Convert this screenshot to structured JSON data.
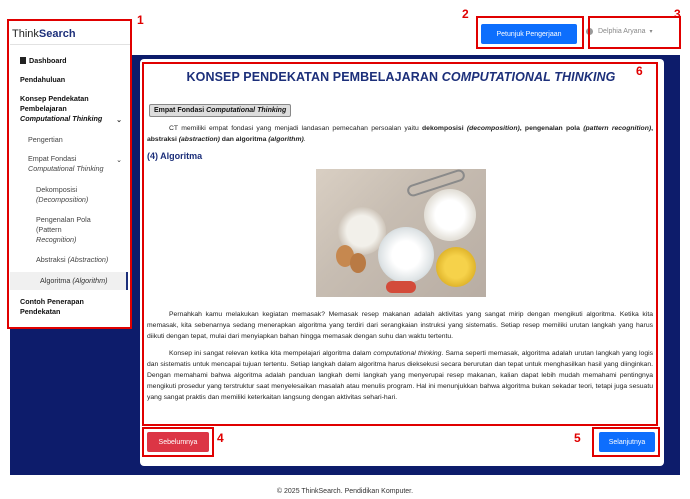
{
  "brand": {
    "prefix": "Think",
    "strong": "Search"
  },
  "topbar": {
    "guide_button": "Petunjuk Pengerjaan",
    "user_name": "Delphia Aryana"
  },
  "sidebar": {
    "items": [
      {
        "label": "Dashboard"
      },
      {
        "label": "Pendahuluan"
      },
      {
        "label_line1": "Konsep Pendekatan",
        "label_line2": "Pembelajaran",
        "label_line3": "Computational Thinking"
      },
      {
        "label": "Pengertian"
      },
      {
        "label_line1": "Empat Fondasi",
        "label_line2": "Computational Thinking"
      },
      {
        "label_line1": "Dekomposisi",
        "label_line2": "(Decomposition)"
      },
      {
        "label_line1": "Pengenalan Pola (Pattern",
        "label_line2": "Recognition)"
      },
      {
        "label_a": "Abstraksi ",
        "label_b": "(Abstraction)"
      },
      {
        "label_a": "Algoritma ",
        "label_b": "(Algorithm)"
      },
      {
        "label_line1": "Contoh Penerapan",
        "label_line2": "Pendekatan"
      }
    ]
  },
  "content": {
    "title_a": "KONSEP PENDEKATAN PEMBELAJARAN ",
    "title_b": "COMPUTATIONAL THINKING",
    "pill_a": "Empat Fondasi ",
    "pill_b": "Computational Thinking",
    "intro_a": "CT memiliki empat fondasi yang menjadi landasan pemecahan persoalan yaitu ",
    "intro_b": "dekomposisi ",
    "intro_c": "(decomposition)",
    "intro_d": ", pengenalan pola ",
    "intro_e": "(pattern recognition)",
    "intro_f": ", abstraksi ",
    "intro_g": "(abstraction)",
    "intro_h": " dan algoritma ",
    "intro_i": "(algorithm)",
    "intro_j": ".",
    "section_heading": "(4) Algoritma",
    "para1": "Pernahkah kamu melakukan kegiatan memasak? Memasak resep makanan adalah aktivitas yang sangat mirip dengan mengikuti algoritma. Ketika kita memasak, kita sebenarnya sedang menerapkan algoritma yang terdiri dari serangkaian instruksi yang sistematis. Setiap resep memiliki urutan langkah yang harus diikuti dengan tepat, mulai dari menyiapkan bahan hingga memasak dengan suhu dan waktu tertentu.",
    "para2_a": "Konsep ini sangat relevan ketika kita mempelajari algoritma dalam ",
    "para2_b": "computational thinking",
    "para2_c": ". Sama seperti memasak, algoritma adalah urutan langkah yang logis dan sistematis untuk mencapai tujuan tertentu. Setiap langkah dalam algoritma harus dieksekusi secara berurutan dan tepat untuk menghasilkan hasil yang diinginkan. Dengan memahami bahwa algoritma adalah panduan langkah demi langkah yang menyerupai resep makanan, kalian dapat lebih mudah memahami pentingnya mengikuti prosedur yang terstruktur saat menyelesaikan masalah atau menulis program. Hal ini menunjukkan bahwa algoritma bukan sekadar teori, tetapi juga sesuatu yang sangat praktis dan memiliki keterkaitan langsung dengan aktivitas sehari-hari."
  },
  "navigation": {
    "prev_button": "Sebelumnya",
    "next_button": "Selanjutnya"
  },
  "footer": {
    "copyright": "© 2025 ThinkSearch. Pendidikan Komputer."
  },
  "annotations": [
    "1",
    "2",
    "3",
    "4",
    "5",
    "6"
  ],
  "colors": {
    "navy": "#0d1c6b",
    "primary": "#0d6efd",
    "danger": "#dc3545",
    "annotation": "#e00000",
    "heading": "#1c2f7a"
  }
}
